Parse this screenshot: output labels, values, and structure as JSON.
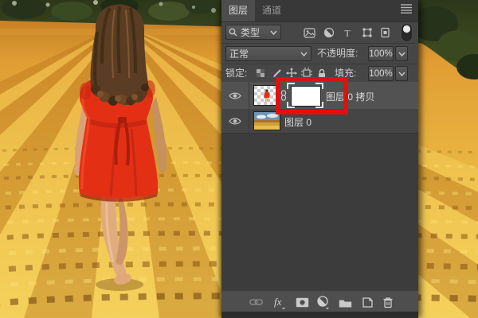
{
  "panel": {
    "tabs": [
      {
        "label": "图层"
      },
      {
        "label": "通道"
      }
    ],
    "filter": {
      "kind_label": "类型"
    },
    "blend": {
      "value": "正常"
    },
    "opacity": {
      "label": "不透明度:",
      "value": "100%"
    },
    "lock": {
      "label": "锁定:"
    },
    "fill": {
      "label": "填充:",
      "value": "100%"
    },
    "layers": [
      {
        "name": "图层 0 拷贝",
        "selected": true,
        "has_mask": true
      },
      {
        "name": "图层 0",
        "selected": false,
        "has_mask": false
      }
    ],
    "toolbar": {
      "effects_label": "fx"
    }
  },
  "icons": {
    "panel_menu": "hamburger-menu",
    "filter_search": "magnifier",
    "filter_buttons": [
      "pixel-layer-filter",
      "adjustment-layer-filter",
      "type-layer-filter",
      "shape-layer-filter",
      "smart-object-filter",
      "layer-filtering-toggle"
    ],
    "lock_buttons": [
      "lock-transparent-checkerboard",
      "lock-image-brush",
      "lock-position-move",
      "lock-artboard",
      "lock-all-padlock"
    ],
    "layer_row": [
      "eye-visibility",
      "layer-thumbnail",
      "chain-link",
      "mask-thumbnail"
    ],
    "bottom_toolbar": [
      "link-layers",
      "layer-effects-fx",
      "add-layer-mask",
      "new-adjustment-layer",
      "new-group-folder",
      "new-layer",
      "delete-trash"
    ]
  },
  "colors": {
    "annotation_red": "#e01010",
    "panel_bg": "#424242",
    "selected_row": "#525252",
    "text": "#d6d6d6",
    "field_gold": "#e9b542",
    "dress_red": "#e33015"
  },
  "annotation": {
    "shape": "rectangle",
    "color": "#e01010"
  }
}
